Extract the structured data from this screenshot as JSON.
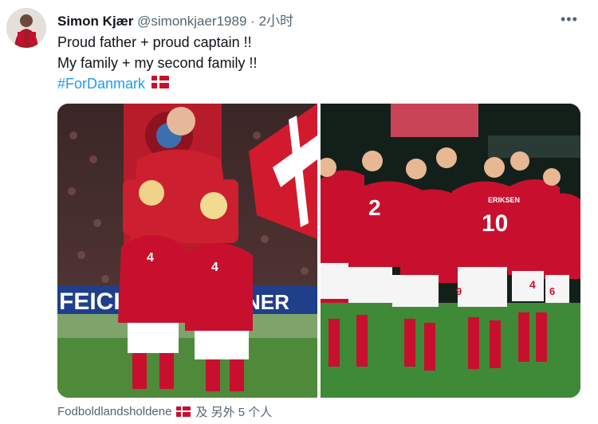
{
  "author": {
    "name": "Simon Kjær",
    "handle": "@simonkjaer1989",
    "separator": "·",
    "time": "2小时"
  },
  "menu": {
    "more_label": "•••"
  },
  "tweet": {
    "line1": "Proud father + proud captain !!",
    "line2": "My family + my second family !!",
    "hashtag": "#ForDanmark"
  },
  "media": {
    "left_description_icon": "photo-father-kids-icon",
    "left_shirt_numbers": [
      "4",
      "4"
    ],
    "left_banner": "FEICIT",
    "left_banner2": "NER",
    "right_shirt_numbers": [
      "2",
      "10",
      "4",
      "6",
      "9"
    ],
    "right_name_on_shirt": "ERIKSEN"
  },
  "tags": {
    "tagged_account": "Fodboldlandsholdene",
    "others": "及 另外 5 个人"
  },
  "colors": {
    "link": "#1d9bf0",
    "secondary_text": "#536471",
    "denmark_red": "#c8102e"
  }
}
